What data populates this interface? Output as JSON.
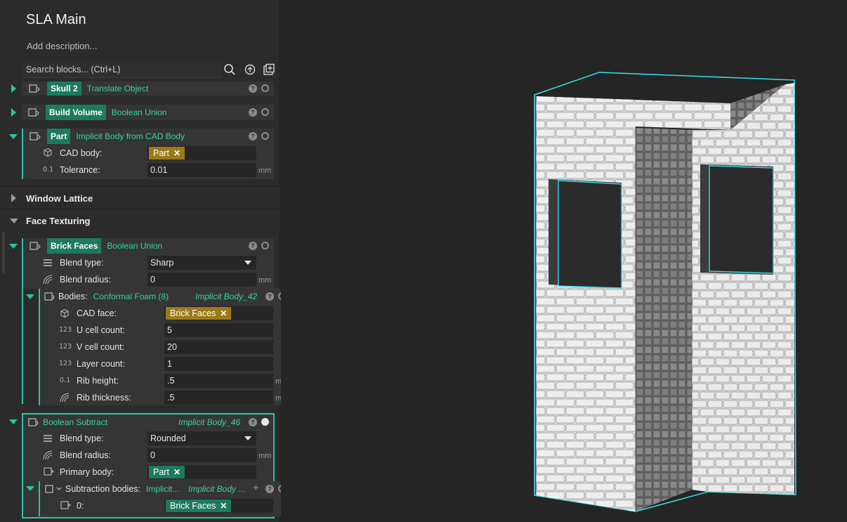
{
  "header": {
    "title": "SLA Main",
    "description": "Add description...",
    "search_placeholder": "Search blocks... (Ctrl+L)"
  },
  "blocks": {
    "skull": {
      "name": "Skull 2",
      "op": "Translate Object"
    },
    "build": {
      "name": "Build Volume",
      "op": "Boolean Union"
    },
    "part": {
      "name": "Part",
      "op": "Implicit Body from CAD Body",
      "cad_label": "CAD body:",
      "cad_value": "Part",
      "tol_label": "Tolerance:",
      "tol_value": "0.01",
      "tol_unit": "mm"
    }
  },
  "sections": {
    "window_lattice": "Window Lattice",
    "face_texturing": "Face Texturing"
  },
  "brick": {
    "name": "Brick Faces",
    "op": "Boolean Union",
    "blend_type_label": "Blend type:",
    "blend_type_value": "Sharp",
    "blend_radius_label": "Blend radius:",
    "blend_radius_value": "0",
    "blend_radius_unit": "mm",
    "bodies_label": "Bodies:",
    "bodies_value": "Conformal Foam (8)",
    "bodies_ref": "Implicit Body_42",
    "cad_face_label": "CAD face:",
    "cad_face_value": "Brick Faces",
    "u_label": "U cell count:",
    "u_value": "5",
    "v_label": "V cell count:",
    "v_value": "20",
    "layer_label": "Layer count:",
    "layer_value": "1",
    "rib_h_label": "Rib height:",
    "rib_h_value": ".5",
    "rib_h_unit": "mm",
    "rib_t_label": "Rib thickness:",
    "rib_t_value": ".5",
    "rib_t_unit": "mm"
  },
  "subtract": {
    "name": "Boolean Subtract",
    "ref": "Implicit Body_46",
    "blend_type_label": "Blend type:",
    "blend_type_value": "Rounded",
    "blend_radius_label": "Blend radius:",
    "blend_radius_value": "0",
    "blend_radius_unit": "mm",
    "primary_label": "Primary body:",
    "primary_value": "Part",
    "sub_label": "Subtraction bodies:",
    "sub_value": "Implicit...",
    "sub_ref": "Implicit Body ...",
    "item0_label": "0:",
    "item0_value": "Brick Faces"
  },
  "icons": {
    "block": "block-icon",
    "search": "search-icon",
    "refresh": "refresh-icon",
    "add": "add-block-icon",
    "help": "help-icon",
    "visibility": "visibility-icon",
    "list": "list-icon",
    "cube": "cube-icon",
    "number": "number-icon",
    "decimal": "decimal-icon",
    "radius": "radius-icon",
    "close": "close-icon",
    "plus": "plus-icon"
  },
  "icon_glyphs": {
    "help": "?",
    "close": "✕",
    "plus": "+",
    "int": "123",
    "dec": "0.1"
  },
  "colors": {
    "accent": "#26c7a6",
    "tag_green": "#1e7a5e",
    "chip_yellow": "#9b7a1a",
    "panel": "#2b2b2b",
    "viewport": "#252525"
  }
}
